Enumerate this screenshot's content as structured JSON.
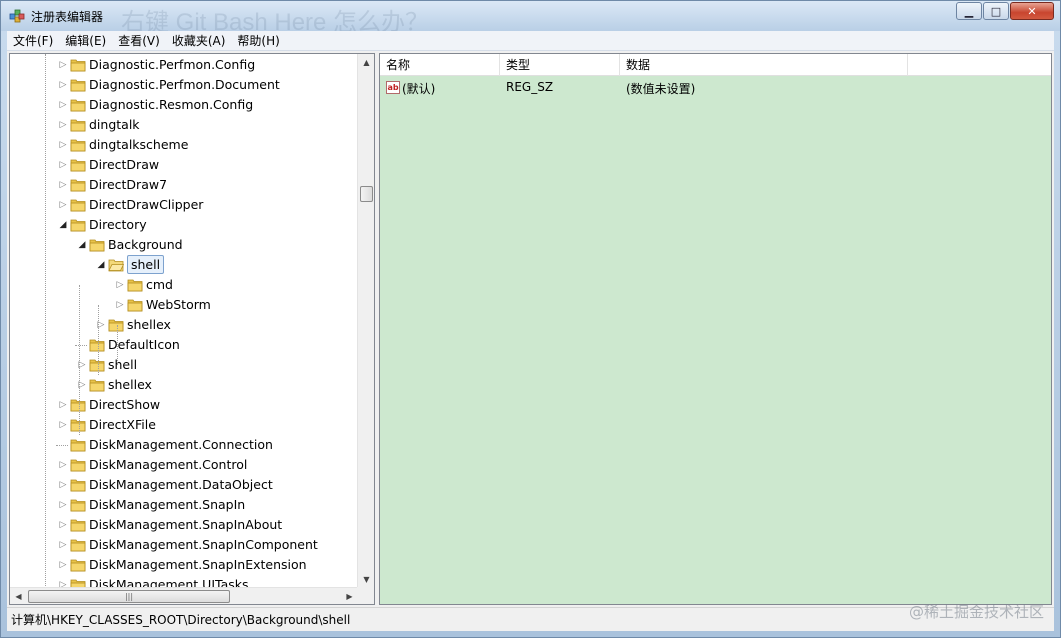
{
  "window": {
    "title": "注册表编辑器",
    "background_title": "右键 Git Bash Here 怎么办？",
    "minimize": "▁",
    "maximize": "□",
    "close": "✕"
  },
  "menu": [
    "文件(F)",
    "编辑(E)",
    "查看(V)",
    "收藏夹(A)",
    "帮助(H)"
  ],
  "tree": [
    {
      "label": "Diagnostic.Perfmon.Config",
      "level": 0,
      "expander": "collapsed"
    },
    {
      "label": "Diagnostic.Perfmon.Document",
      "level": 0,
      "expander": "collapsed"
    },
    {
      "label": "Diagnostic.Resmon.Config",
      "level": 0,
      "expander": "collapsed"
    },
    {
      "label": "dingtalk",
      "level": 0,
      "expander": "collapsed"
    },
    {
      "label": "dingtalkscheme",
      "level": 0,
      "expander": "collapsed"
    },
    {
      "label": "DirectDraw",
      "level": 0,
      "expander": "collapsed"
    },
    {
      "label": "DirectDraw7",
      "level": 0,
      "expander": "collapsed"
    },
    {
      "label": "DirectDrawClipper",
      "level": 0,
      "expander": "collapsed"
    },
    {
      "label": "Directory",
      "level": 0,
      "expander": "expanded"
    },
    {
      "label": "Background",
      "level": 1,
      "expander": "expanded"
    },
    {
      "label": "shell",
      "level": 2,
      "expander": "expanded",
      "selected": true
    },
    {
      "label": "cmd",
      "level": 3,
      "expander": "collapsed"
    },
    {
      "label": "WebStorm",
      "level": 3,
      "expander": "collapsed"
    },
    {
      "label": "shellex",
      "level": 2,
      "expander": "collapsed"
    },
    {
      "label": "DefaultIcon",
      "level": 1,
      "expander": "none"
    },
    {
      "label": "shell",
      "level": 1,
      "expander": "collapsed"
    },
    {
      "label": "shellex",
      "level": 1,
      "expander": "collapsed"
    },
    {
      "label": "DirectShow",
      "level": 0,
      "expander": "collapsed"
    },
    {
      "label": "DirectXFile",
      "level": 0,
      "expander": "collapsed"
    },
    {
      "label": "DiskManagement.Connection",
      "level": 0,
      "expander": "none"
    },
    {
      "label": "DiskManagement.Control",
      "level": 0,
      "expander": "collapsed"
    },
    {
      "label": "DiskManagement.DataObject",
      "level": 0,
      "expander": "collapsed"
    },
    {
      "label": "DiskManagement.SnapIn",
      "level": 0,
      "expander": "collapsed"
    },
    {
      "label": "DiskManagement.SnapInAbout",
      "level": 0,
      "expander": "collapsed"
    },
    {
      "label": "DiskManagement.SnapInComponent",
      "level": 0,
      "expander": "collapsed"
    },
    {
      "label": "DiskManagement.SnapInExtension",
      "level": 0,
      "expander": "collapsed"
    },
    {
      "label": "DiskManagement.UITasks",
      "level": 0,
      "expander": "collapsed"
    }
  ],
  "list": {
    "columns": [
      "名称",
      "类型",
      "数据"
    ],
    "rows": [
      {
        "name": "(默认)",
        "type": "REG_SZ",
        "data": "(数值未设置)",
        "icon": "ab"
      }
    ]
  },
  "status": {
    "path": "计算机\\HKEY_CLASSES_ROOT\\Directory\\Background\\shell"
  },
  "watermark": "@稀土掘金技术社区",
  "colors": {
    "list_background": "#cde8cf",
    "folder": "#e8c34a"
  }
}
